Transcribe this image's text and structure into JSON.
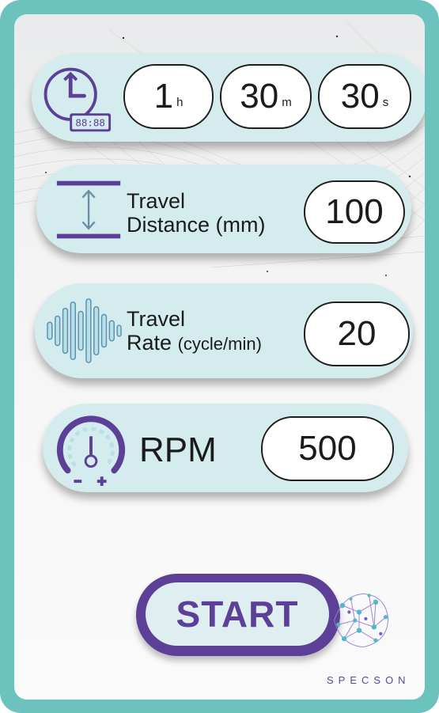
{
  "timer": {
    "hours": "1",
    "hours_unit": "h",
    "minutes": "30",
    "minutes_unit": "m",
    "seconds": "30",
    "seconds_unit": "s",
    "icon": "clock-timer-icon"
  },
  "travel_distance": {
    "label_line1": "Travel",
    "label_line2": "Distance (mm)",
    "value": "100",
    "icon": "vertical-distance-icon"
  },
  "travel_rate": {
    "label_line1": "Travel",
    "label_line2a": "Rate",
    "label_line2b": "(cycle/min)",
    "value": "20",
    "icon": "sound-wave-icon"
  },
  "rpm": {
    "label": "RPM",
    "value": "500",
    "icon": "speed-gauge-icon"
  },
  "start_button": {
    "label": "START"
  },
  "brand": {
    "name": "SPECSON",
    "icon": "brain-network-logo"
  },
  "colors": {
    "frame": "#6cc3bd",
    "accent_purple": "#5c3f96",
    "pill_bg": "#d5ecee"
  }
}
